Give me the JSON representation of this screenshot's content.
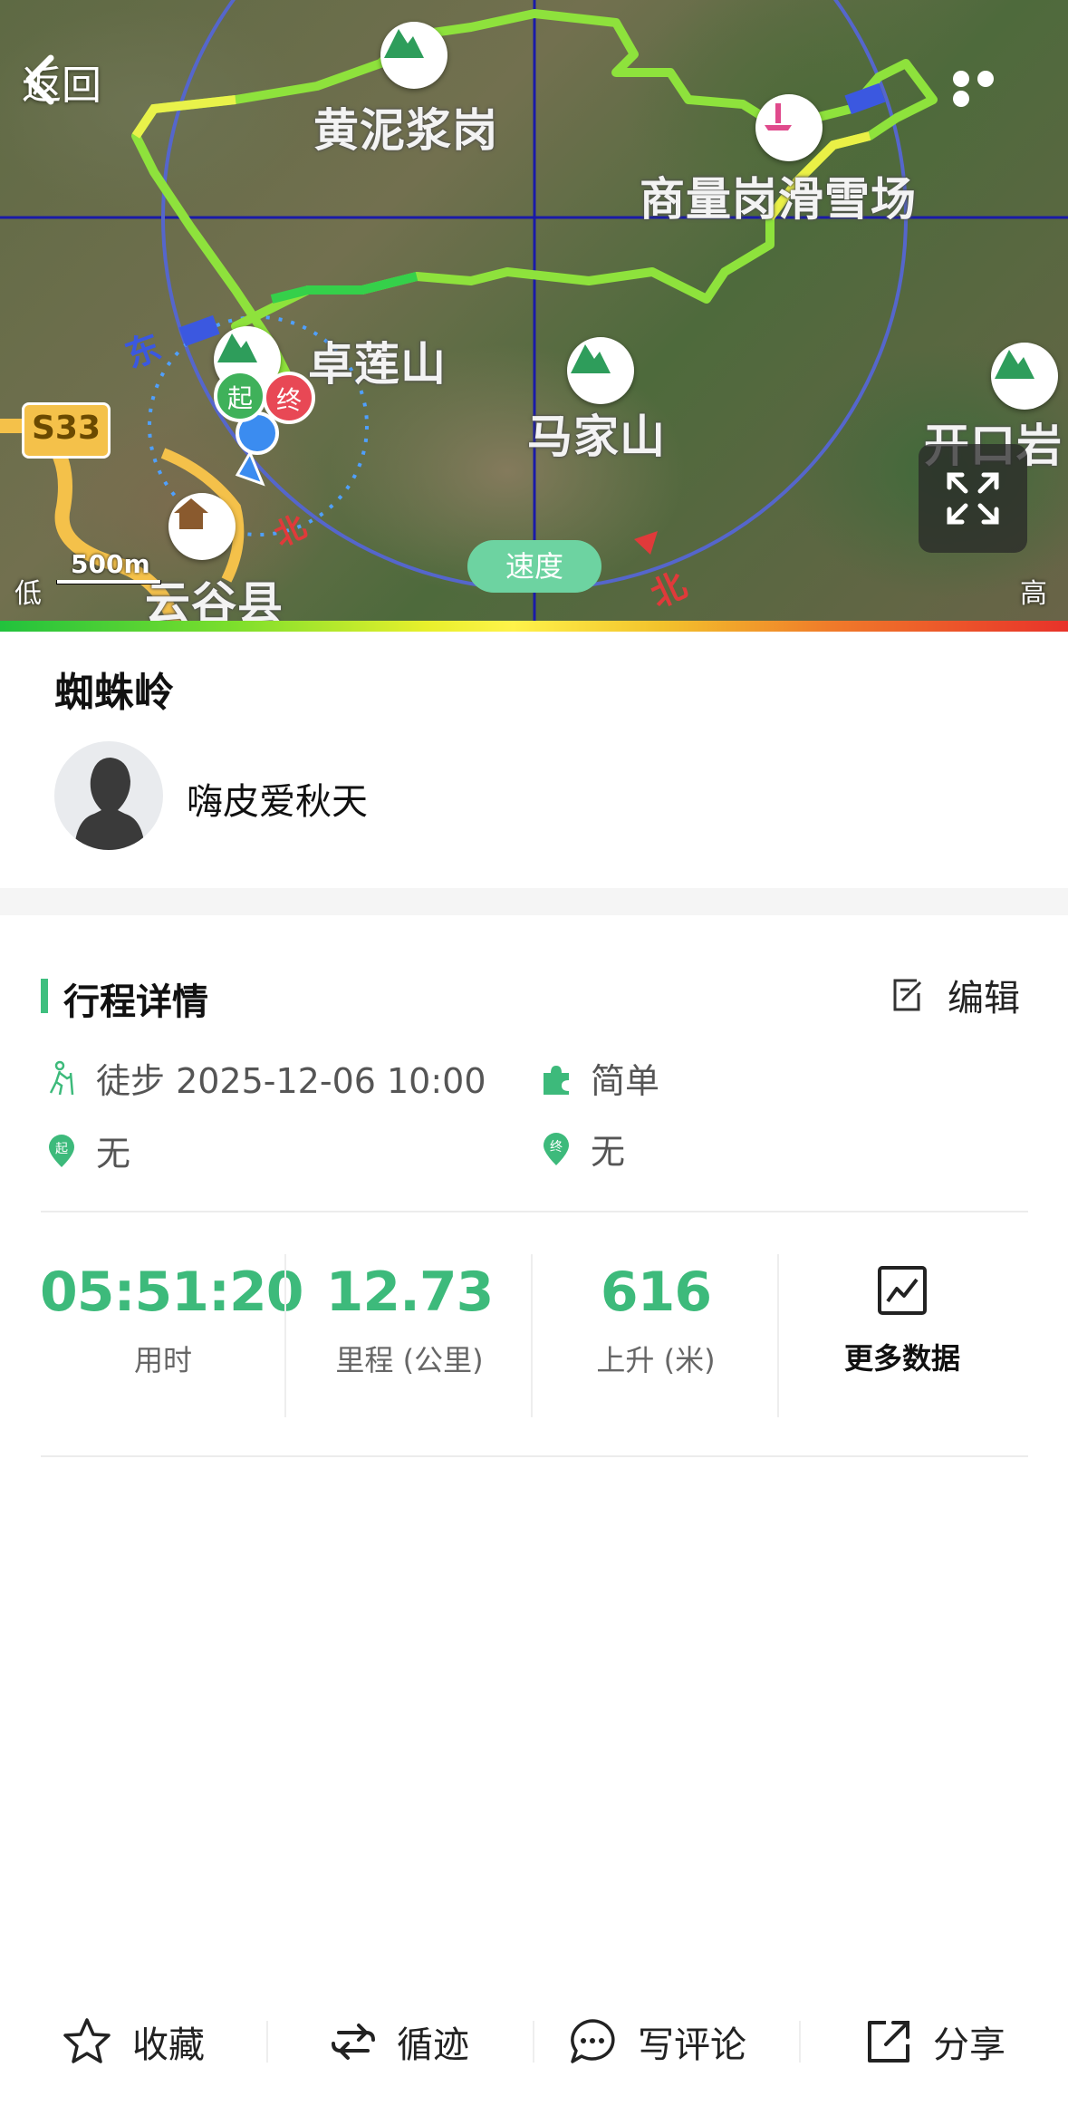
{
  "nav": {
    "back_label": "返回"
  },
  "map": {
    "labels": {
      "huangnijiang": "黄泥浆岗",
      "shangzhuang": "商量岗滑雪场",
      "fuchuan": "卓莲山",
      "majiashan": "马家山",
      "kaikouyan": "开口岩",
      "county": "云谷县"
    },
    "road_badge": "S33",
    "start_marker": "起",
    "end_marker": "终",
    "speed_pill": "速度",
    "scale": "500m",
    "legend_low": "低",
    "legend_high": "高"
  },
  "route": {
    "title": "蜘蛛岭",
    "user_name": "嗨皮爱秋天"
  },
  "details": {
    "section_title": "行程详情",
    "edit_label": "编辑",
    "activity": "徒步 2025-12-06 10:00",
    "difficulty": "简单",
    "start_place": "无",
    "end_place": "无",
    "start_icon_text": "起",
    "end_icon_text": "终"
  },
  "stats": {
    "duration": {
      "value": "05:51:20",
      "label": "用时"
    },
    "distance": {
      "value": "12.73",
      "label": "里程 (公里)"
    },
    "ascent": {
      "value": "616",
      "label": "上升 (米)"
    },
    "more_label": "更多数据"
  },
  "bottom_bar": {
    "favorite": "收藏",
    "follow_track": "循迹",
    "comment": "写评论",
    "share": "分享"
  },
  "colors": {
    "accent": "#3dba7b",
    "track": "#9ee23c",
    "end_marker": "#e84855",
    "start_marker": "#3fb15a"
  }
}
